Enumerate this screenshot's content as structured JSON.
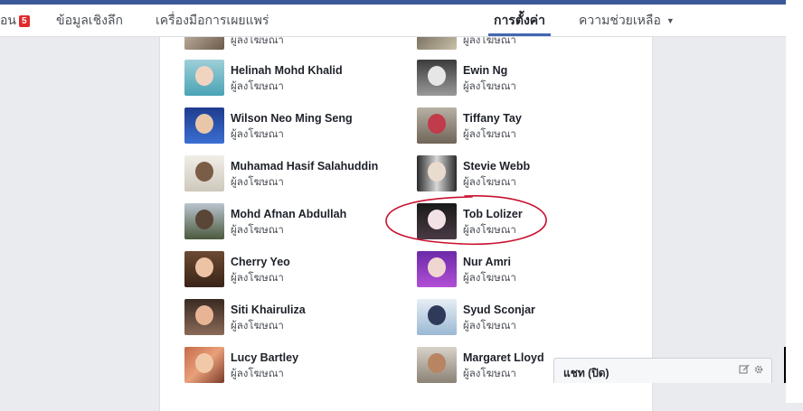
{
  "nav": {
    "tabs": [
      {
        "label": "ีอน",
        "badge": "5"
      },
      {
        "label": "ข้อมูลเชิงลึก"
      },
      {
        "label": "เครื่องมือการเผยแพร่"
      },
      {
        "label": "การตั้งค่า",
        "active": true
      },
      {
        "label": "ความช่วยเหลือ",
        "caret": "▼"
      }
    ]
  },
  "role_label": "ผู้ลงโฆษณา",
  "people": [
    {
      "name": "Helinah Mohd Khalid",
      "role": "ผู้ลงโฆษณา"
    },
    {
      "name": "Ewin Ng",
      "role": "ผู้ลงโฆษณา"
    },
    {
      "name": "Wilson Neo Ming Seng",
      "role": "ผู้ลงโฆษณา"
    },
    {
      "name": "Tiffany Tay",
      "role": "ผู้ลงโฆษณา"
    },
    {
      "name": "Muhamad Hasif Salahuddin",
      "role": "ผู้ลงโฆษณา"
    },
    {
      "name": "Stevie Webb",
      "role": "ผู้ลงโฆษณา"
    },
    {
      "name": "Mohd Afnan Abdullah",
      "role": "ผู้ลงโฆษณา"
    },
    {
      "name": "Tob Lolizer",
      "role": "ผู้ลงโฆษณา"
    },
    {
      "name": "Cherry Yeo",
      "role": "ผู้ลงโฆษณา"
    },
    {
      "name": "Nur Amri",
      "role": "ผู้ลงโฆษณา"
    },
    {
      "name": "Siti Khairuliza",
      "role": "ผู้ลงโฆษณา"
    },
    {
      "name": "Syud Sconjar",
      "role": "ผู้ลงโฆษณา"
    },
    {
      "name": "Lucy Bartley",
      "role": "ผู้ลงโฆษณา"
    },
    {
      "name": "Margaret Lloyd",
      "role": "ผู้ลงโฆษณา"
    }
  ],
  "chat": {
    "label": "แชท (ปิด)",
    "icons": [
      "compose-icon",
      "gear-icon"
    ]
  },
  "colors": {
    "accent": "#3b5998",
    "badge": "#e22a2a",
    "highlight_circle": "#c8102e"
  }
}
